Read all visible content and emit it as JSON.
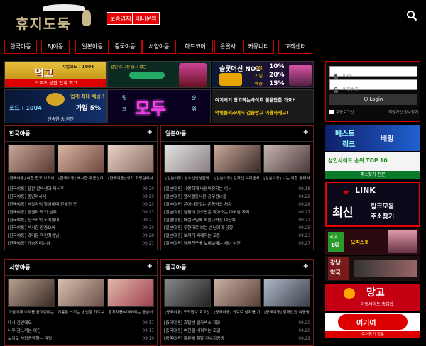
{
  "header": {
    "logo_text": "휴지도둑",
    "buttons": [
      "보증업체",
      "배너문의"
    ]
  },
  "nav": [
    "한국야동",
    "BJ야동",
    "일본야동",
    "중국야동",
    "서양야동",
    "하드코어",
    "은꼴사",
    "커뮤니티",
    "고객센터"
  ],
  "banners": {
    "b1_top": "가입코드 : 1004",
    "b1_big": "먹고",
    "b1_bottom": "스포츠 상한 업계 최고",
    "b2_top": "캡틴 토지상 중지 없는",
    "b3_title": "슬롯머신 NO1",
    "b3_percents": [
      "10%",
      "20%",
      "11%",
      "15%"
    ],
    "b3_words": [
      "주말",
      "가입",
      "매충"
    ],
    "b4_code": "코드 : 1004",
    "b4_right": "가입 5%",
    "b4_top": "업계 최대 배팅 !",
    "b4_sub": "신속한 승,환전",
    "b5_big": "모두",
    "b5_small": [
      "링",
      "크",
      "순",
      "위"
    ],
    "b6_l1": "여기저기 광고하는사이트 믿을만한 가요?",
    "b6_l2": "먹튀폴리스에서 검증받고 이용하세요!"
  },
  "sections": [
    {
      "title": "한국야동",
      "more": "+",
      "captions": [
        "[한국야동] 여친 친구 보지에",
        "[한국야동] 섹시한 무용선어",
        "[한국야동] 상가 화장실에서"
      ],
      "rows": [
        [
          "[한국야동] 끝판 알바생과 찍식후",
          "09.20"
        ],
        [
          "[한국야동] 중년여사세",
          "09.29"
        ],
        [
          "[한국야동] 세상처럼 말애내며 잔해진 뜻",
          "09.23"
        ],
        [
          "[한국야동] 광센터 먹기 실제",
          "09.23"
        ],
        [
          "[한국야동] 진구커의 노에놈어",
          "09.27"
        ],
        [
          "[한국야동] 섹시한 잔중요어",
          "09.30"
        ],
        [
          "[한국야동] 과미운 역핀최생님",
          "09.28"
        ],
        [
          "[한국야동] 가슴지리는녀",
          "09.27"
        ]
      ]
    },
    {
      "title": "일본야동",
      "more": "+",
      "captions": [
        "[일본야동] 영호선생님을맞",
        "[일본야동] 김가인 여대생처",
        "[일본야동] 나는 여친 몰래서"
      ],
      "rows": [
        [
          "[일본야동] 사랑하게 바뀐미장하는 여서",
          "09.18"
        ],
        [
          "[일본야동] 봉사활동나온 공무원녀를",
          "09.22"
        ],
        [
          "[일본야동] 은아나동발는 온몸박의 처자",
          "09.28"
        ],
        [
          "[일본야동] 남편이 없으면은 찾아오는 아버님 자지",
          "09.27"
        ],
        [
          "[일본야동] 아련모임에 처음나와진 여친에",
          "09.22"
        ],
        [
          "[일본야동] 무한데로 보는 손님에게 당항",
          "09.25"
        ],
        [
          "[일본야동] 보지가 찌께지는 교동",
          "09.23"
        ],
        [
          "[일본야동] 남자친구를 보내보내는 세녀 여전",
          "09.27"
        ]
      ]
    },
    {
      "title": "서양야동",
      "more": "+",
      "captions": [
        "아들에게 보지를 금이던라는",
        "기름을 느끼는 방법을 가르쳐",
        "참지계를여어버러는 금발녀"
      ],
      "rows": [
        [
          "대서 검인에도",
          "09.17"
        ],
        [
          "너무 참느끼는 여친",
          "09.17"
        ],
        [
          "보지로 사장공득하는 마당",
          "09.19"
        ]
      ]
    },
    {
      "title": "중국야동",
      "more": "+",
      "captions": [
        "[중국야동] 도도한다 학교선",
        "[중국야동] 의료로 남자를 기",
        "[중국야동] 잠깨없전 여동생"
      ],
      "rows": [
        [
          "[중국야동] 호텔방 셀카섹스 제공",
          "09.20"
        ],
        [
          "[중국야동] 여전을 바꿔먹는 모델",
          "09.20"
        ],
        [
          "[중국야동] 불륜에 휘말 가수지망생",
          "09.29"
        ]
      ]
    }
  ],
  "login": {
    "id_placeholder": "아이디",
    "pw_placeholder": "비밀번호",
    "button": "Login",
    "remember": "자동로그인",
    "links": [
      "회원가입",
      "정보찾기"
    ]
  },
  "side": {
    "s1_l1": "베스트",
    "s1_l2": "링크",
    "s1_l3": "베링",
    "s2_l1": "성인사이트 순위 TOP 10",
    "s2_l2": "주소찾기 전문",
    "s3_l1": "LINK",
    "s3_l2": "최신",
    "s3_l3": "링크모음",
    "s3_l4": "주소찾기",
    "s4_l1": "국내",
    "s4_l2": "1위",
    "s4_l3": "오피스북",
    "s5_l1": "강남",
    "s5_l2": "약국",
    "s6_l1": "망고",
    "s6_l2": "야동사이트 총집합",
    "s7_l1": "여기여",
    "s7_l2": "주소찾기 전문"
  },
  "colors": {
    "accent": "#e40000",
    "border": "#7a1a1a"
  }
}
